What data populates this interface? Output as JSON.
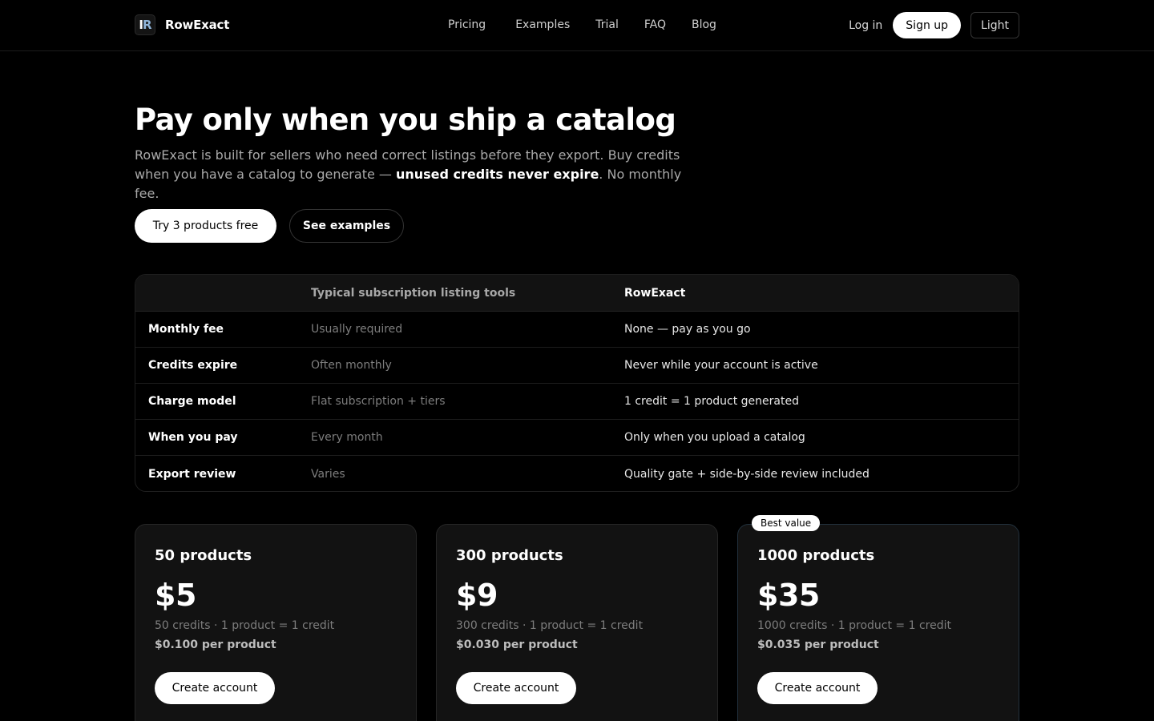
{
  "nav": {
    "logo_bar": "I",
    "logo_letter": "R",
    "brand": "RowExact",
    "links": [
      "Pricing",
      "Examples",
      "Trial",
      "FAQ",
      "Blog"
    ],
    "login": "Log in",
    "signup": "Sign up",
    "theme": "Light"
  },
  "hero": {
    "title": "Pay only when you ship a catalog",
    "subtitle_pre": "RowExact is built for sellers who need correct listings before they export. Buy credits when you have a catalog to generate — ",
    "subtitle_bold": "unused credits never expire",
    "subtitle_post": ". No monthly fee.",
    "cta_primary": "Try 3 products free",
    "cta_secondary": "See examples"
  },
  "comparison": {
    "headers": [
      "",
      "Typical subscription listing tools",
      "RowExact"
    ],
    "rows": [
      [
        "Monthly fee",
        "Usually required",
        "None — pay as you go"
      ],
      [
        "Credits expire",
        "Often monthly",
        "Never while your account is active"
      ],
      [
        "Charge model",
        "Flat subscription + tiers",
        "1 credit = 1 product generated"
      ],
      [
        "When you pay",
        "Every month",
        "Only when you upload a catalog"
      ],
      [
        "Export review",
        "Varies",
        "Quality gate + side-by-side review included"
      ]
    ]
  },
  "plans": [
    {
      "title": "50 products",
      "price": "$5",
      "credits": "50 credits · 1 product = 1 credit",
      "per": "$0.100 per product",
      "button": "Create account"
    },
    {
      "title": "300 products",
      "price": "$9",
      "credits": "300 credits · 1 product = 1 credit",
      "per": "$0.030 per product",
      "button": "Create account"
    },
    {
      "title": "1000 products",
      "price": "$35",
      "credits": "1000 credits · 1 product = 1 credit",
      "per": "$0.035 per product",
      "button": "Create account",
      "badge": "Best value"
    }
  ],
  "colors": {
    "background": "#000000",
    "card": "#121212",
    "accent": "#ffffff",
    "logo_accent": "#8fb4d8"
  }
}
